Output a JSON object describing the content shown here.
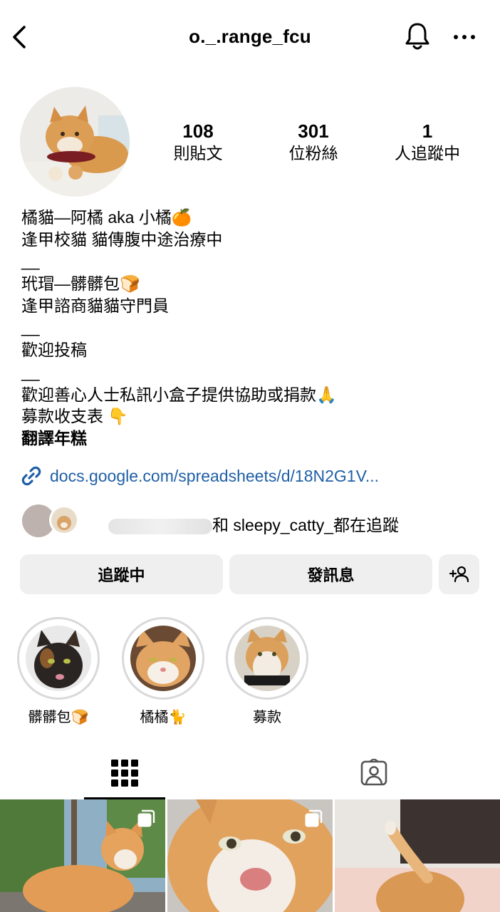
{
  "header": {
    "username": "o._.range_fcu",
    "back_icon": "chevron-left-icon",
    "bell_icon": "bell-icon",
    "more_icon": "more-horizontal-icon"
  },
  "stats": {
    "posts": {
      "value": "108",
      "label": "則貼文"
    },
    "followers": {
      "value": "301",
      "label": "位粉絲"
    },
    "following": {
      "value": "1",
      "label": "人追蹤中"
    }
  },
  "bio": {
    "lines": [
      "橘貓—阿橘 aka 小橘🍊",
      "逢甲校貓 貓傳腹中途治療中",
      "__",
      "玳瑁—髒髒包🍞",
      "逢甲諮商貓貓守門員",
      "__",
      "歡迎投稿",
      "__",
      "歡迎善心人士私訊小盒子提供協助或捐款🙏",
      "募款收支表 👇",
      "翻譯年糕"
    ]
  },
  "link": {
    "text": "docs.google.com/spreadsheets/d/18N2G1V...",
    "icon": "link-icon"
  },
  "mutual": {
    "connector": "和",
    "name": "sleepy_catty_",
    "suffix": "都在追蹤"
  },
  "actions": {
    "following_label": "追蹤中",
    "message_label": "發訊息",
    "add_icon": "add-person-icon"
  },
  "highlights": [
    {
      "label": "髒髒包🍞"
    },
    {
      "label": "橘橘🐈"
    },
    {
      "label": "募款"
    }
  ],
  "tabs": {
    "grid_icon": "grid-icon",
    "tagged_icon": "tagged-person-icon"
  },
  "colors": {
    "link": "#1f5fa6",
    "button_bg": "#efefef",
    "ring": "#d9d9dc"
  }
}
